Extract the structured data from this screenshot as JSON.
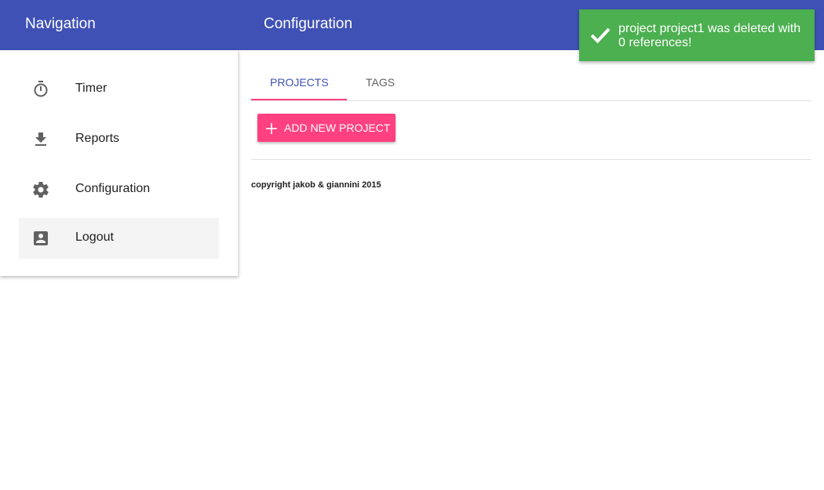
{
  "header": {
    "nav_title": "Navigation",
    "page_title": "Configuration",
    "color": "#3f51b5"
  },
  "sidebar": {
    "items": [
      {
        "label": "Timer",
        "icon": "timer-icon"
      },
      {
        "label": "Reports",
        "icon": "download-icon"
      },
      {
        "label": "Configuration",
        "icon": "gear-icon"
      },
      {
        "label": "Logout",
        "icon": "account-box-icon",
        "active": true
      }
    ]
  },
  "tabs": [
    {
      "label": "PROJECTS",
      "active": true
    },
    {
      "label": "TAGS",
      "active": false
    }
  ],
  "actions": {
    "add_project_label": "ADD NEW PROJECT",
    "icon": "plus-icon",
    "color": "#ff4081"
  },
  "footer": {
    "copyright": "copyright jakob & giannini 2015"
  },
  "toast": {
    "message": "project project1 was deleted with 0 references!",
    "icon": "check-icon",
    "color": "#4caf50"
  }
}
